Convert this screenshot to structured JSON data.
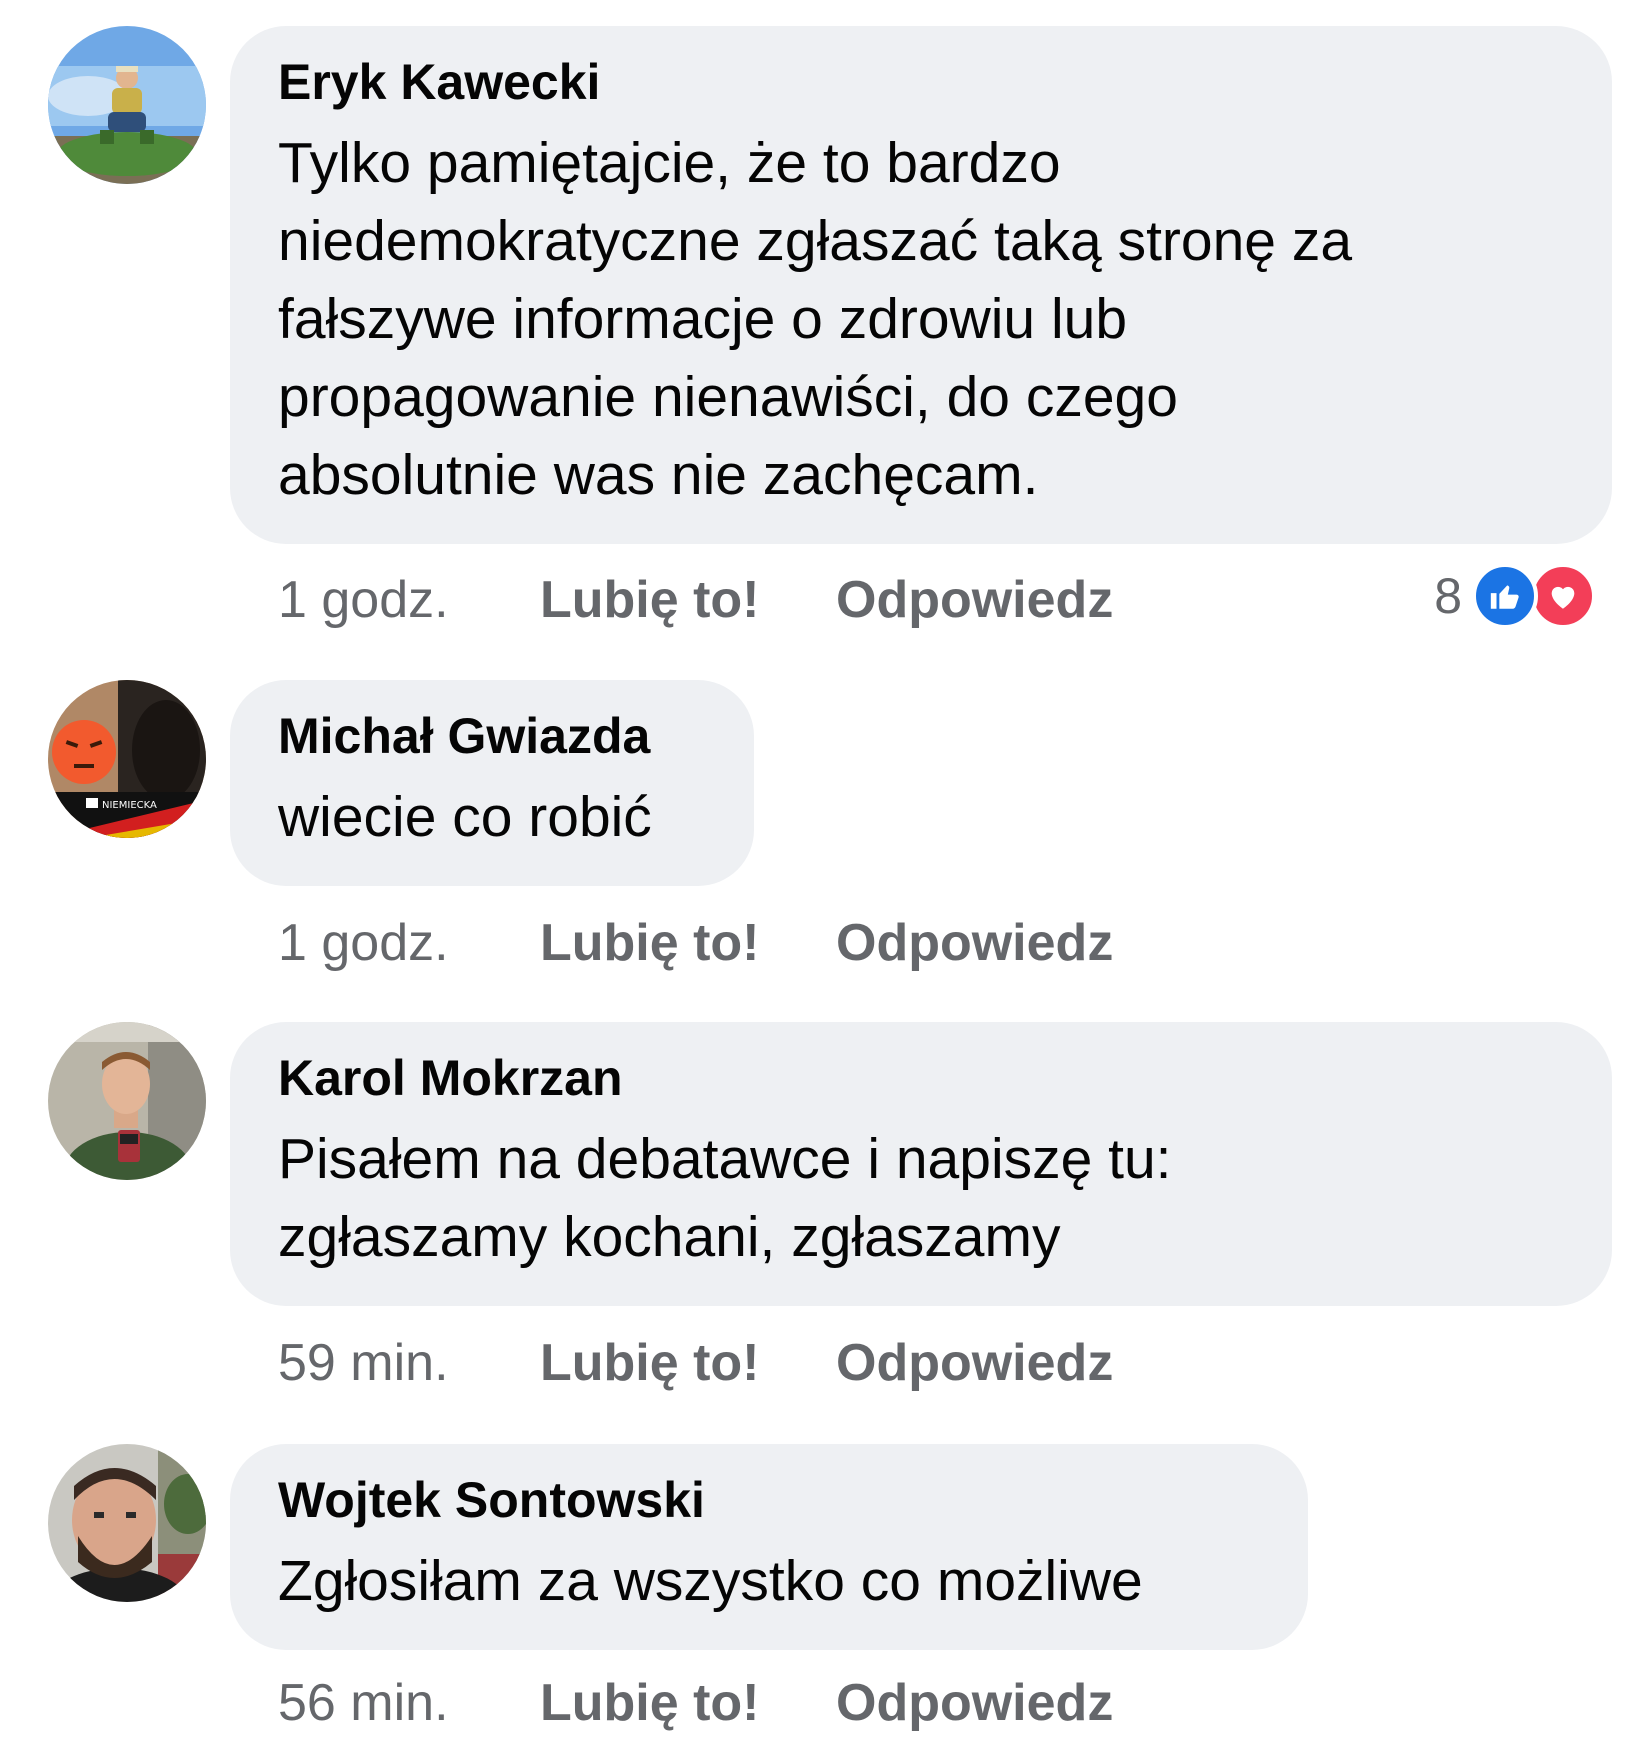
{
  "comments": [
    {
      "author": "Eryk Kawecki",
      "text": "Tylko pamiętajcie, że to bardzo\nniedemokratyczne zgłaszać taką stronę za\nfałszywe informacje o zdrowiu lub\npropagowanie nienawiści, do czego\nabsolutnie was nie zachęcam.",
      "time": "1 godz.",
      "like_label": "Lubię to!",
      "reply_label": "Odpowiedz",
      "reaction_count": "8",
      "reactions": [
        "like-icon",
        "love-icon"
      ]
    },
    {
      "author": "Michał Gwiazda",
      "text": "wiecie co robić",
      "time": "1 godz.",
      "like_label": "Lubię to!",
      "reply_label": "Odpowiedz",
      "avatar_badge_text": "NIEMIECKA"
    },
    {
      "author": "Karol Mokrzan",
      "text": "Pisałem na debatawce i napiszę tu:\nzgłaszamy kochani, zgłaszamy",
      "time": "59 min.",
      "like_label": "Lubię to!",
      "reply_label": "Odpowiedz"
    },
    {
      "author": "Wojtek Sontowski",
      "text": "Zgłosiłam za wszystko co możliwe",
      "time": "56 min.",
      "like_label": "Lubię to!",
      "reply_label": "Odpowiedz"
    }
  ],
  "colors": {
    "bubble_bg": "#eef0f3",
    "meta_text": "#65676b",
    "like_blue": "#1b74e4",
    "love_red": "#f33e58"
  }
}
